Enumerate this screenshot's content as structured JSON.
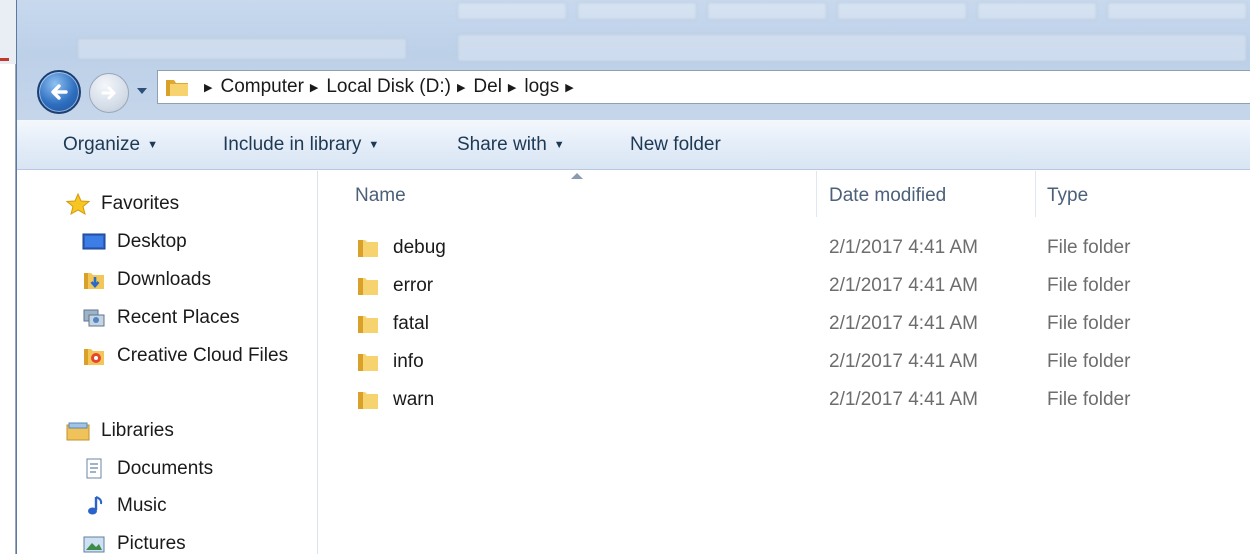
{
  "address": {
    "crumbs": [
      "Computer",
      "Local Disk (D:)",
      "Del",
      "logs"
    ]
  },
  "commands": {
    "organize": "Organize",
    "include_in_library": "Include in library",
    "share_with": "Share with",
    "new_folder": "New folder"
  },
  "nav": {
    "favorites_header": "Favorites",
    "favorites": [
      "Desktop",
      "Downloads",
      "Recent Places",
      "Creative Cloud Files"
    ],
    "libraries_header": "Libraries",
    "libraries": [
      "Documents",
      "Music",
      "Pictures"
    ]
  },
  "columns": {
    "name": "Name",
    "date_modified": "Date modified",
    "type": "Type"
  },
  "files": [
    {
      "name": "debug",
      "date": "2/1/2017 4:41 AM",
      "type": "File folder"
    },
    {
      "name": "error",
      "date": "2/1/2017 4:41 AM",
      "type": "File folder"
    },
    {
      "name": "fatal",
      "date": "2/1/2017 4:41 AM",
      "type": "File folder"
    },
    {
      "name": "info",
      "date": "2/1/2017 4:41 AM",
      "type": "File folder"
    },
    {
      "name": "warn",
      "date": "2/1/2017 4:41 AM",
      "type": "File folder"
    }
  ],
  "icons": {
    "back": "back-arrow-icon",
    "forward": "forward-arrow-icon",
    "folder": "folder-icon",
    "star": "star-icon",
    "desktop": "desktop-icon",
    "downloads": "downloads-icon",
    "recent": "recent-places-icon",
    "creative_cloud": "creative-cloud-icon",
    "libraries": "libraries-icon",
    "documents": "documents-icon",
    "music": "music-icon",
    "pictures": "pictures-icon"
  },
  "colors": {
    "accent_blue": "#2e6fc0",
    "command_text": "#1e3954",
    "header_text": "#4c607a",
    "secondary_text": "#6d6d6d",
    "folder_yellow": "#f3c65a"
  }
}
